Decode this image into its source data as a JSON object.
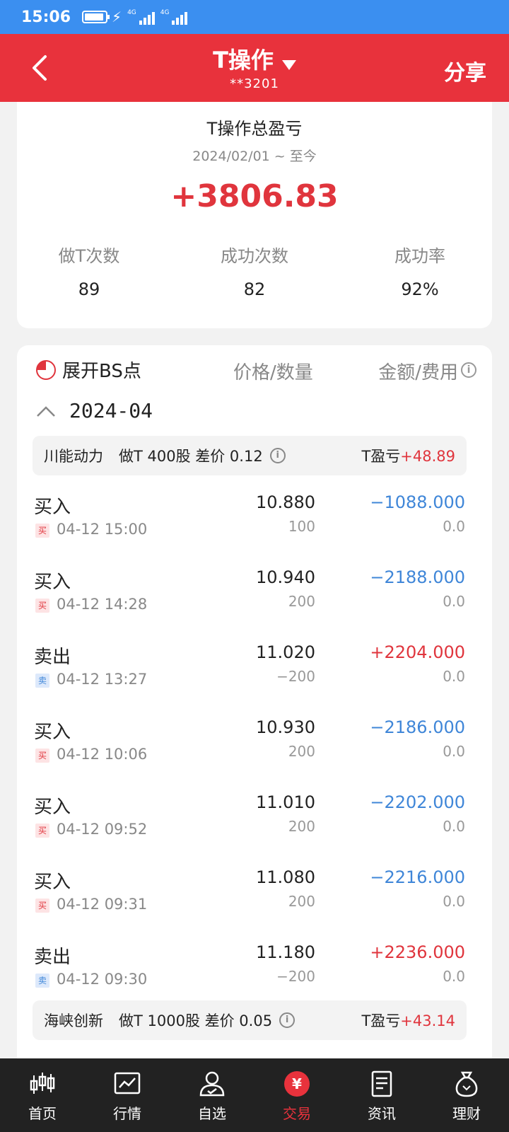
{
  "status_bar": {
    "time": "15:06",
    "net1": "4G",
    "net2": "4G"
  },
  "header": {
    "title": "T操作",
    "account": "**3201",
    "share": "分享"
  },
  "summary": {
    "title": "T操作总盈亏",
    "date_range": "2024/02/01 ~ 至今",
    "total": "+3806.83",
    "stats": [
      {
        "label": "做T次数",
        "value": "89"
      },
      {
        "label": "成功次数",
        "value": "82"
      },
      {
        "label": "成功率",
        "value": "92%"
      }
    ]
  },
  "detail": {
    "toggle_label": "展开BS点",
    "col_price": "价格/数量",
    "col_amount": "金额/费用",
    "info_glyph": "i",
    "month": "2024-04",
    "stocks": [
      {
        "name": "川能动力",
        "info": "做T 400股 差价 0.12",
        "tpl_label": "T盈亏",
        "tpl_value": "+48.89"
      },
      {
        "name": "海峡创新",
        "info": "做T 1000股 差价 0.05",
        "tpl_label": "T盈亏",
        "tpl_value": "+43.14"
      }
    ],
    "trades": [
      {
        "side": "买入",
        "tag": "买",
        "time": "04-12 15:00",
        "price": "10.880",
        "qty": "100",
        "amount": "−1088.000",
        "fee": "0.0"
      },
      {
        "side": "买入",
        "tag": "买",
        "time": "04-12 14:28",
        "price": "10.940",
        "qty": "200",
        "amount": "−2188.000",
        "fee": "0.0"
      },
      {
        "side": "卖出",
        "tag": "卖",
        "time": "04-12 13:27",
        "price": "11.020",
        "qty": "−200",
        "amount": "+2204.000",
        "fee": "0.0"
      },
      {
        "side": "买入",
        "tag": "买",
        "time": "04-12 10:06",
        "price": "10.930",
        "qty": "200",
        "amount": "−2186.000",
        "fee": "0.0"
      },
      {
        "side": "买入",
        "tag": "买",
        "time": "04-12 09:52",
        "price": "11.010",
        "qty": "200",
        "amount": "−2202.000",
        "fee": "0.0"
      },
      {
        "side": "买入",
        "tag": "买",
        "time": "04-12 09:31",
        "price": "11.080",
        "qty": "200",
        "amount": "−2216.000",
        "fee": "0.0"
      },
      {
        "side": "卖出",
        "tag": "卖",
        "time": "04-12 09:30",
        "price": "11.180",
        "qty": "−200",
        "amount": "+2236.000",
        "fee": "0.0"
      }
    ]
  },
  "nav": [
    {
      "label": "首页",
      "icon": "candlestick-icon"
    },
    {
      "label": "行情",
      "icon": "chart-icon"
    },
    {
      "label": "自选",
      "icon": "person-check-icon"
    },
    {
      "label": "交易",
      "icon": "yen-icon",
      "glyph": "¥"
    },
    {
      "label": "资讯",
      "icon": "document-icon"
    },
    {
      "label": "理财",
      "icon": "money-bag-icon"
    }
  ],
  "colors": {
    "header": "#e8323c",
    "statusbar": "#3b8ff0",
    "gain": "#e0353d",
    "loss": "#3f86d8",
    "nav": "#222222"
  }
}
